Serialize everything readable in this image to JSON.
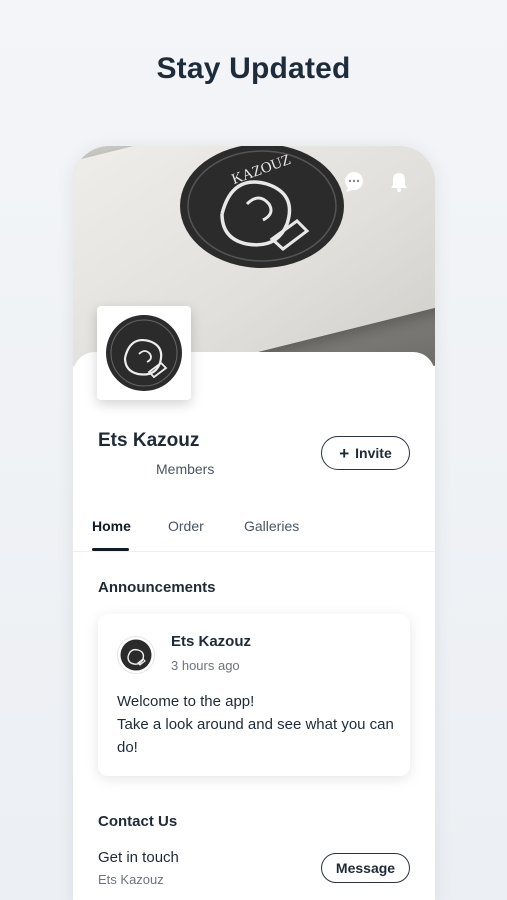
{
  "headline": "Stay Updated",
  "cover": {
    "chat_icon": "chat-bubble-icon",
    "bell_icon": "bell-icon",
    "logo_text": "KAZOUZ"
  },
  "group": {
    "name": "Ets Kazouz",
    "members_label": "Members",
    "invite_label": "Invite"
  },
  "tabs": [
    {
      "label": "Home",
      "active": true
    },
    {
      "label": "Order",
      "active": false
    },
    {
      "label": "Galleries",
      "active": false
    }
  ],
  "announcements": {
    "title": "Announcements",
    "post": {
      "author": "Ets Kazouz",
      "time": "3 hours ago",
      "body": "Welcome to the app!\nTake a look around and see what you can do!"
    }
  },
  "contact": {
    "title": "Contact Us",
    "subtitle": "Get in touch",
    "name": "Ets Kazouz",
    "message_label": "Message"
  },
  "colors": {
    "text_primary": "#1f2a37",
    "headline": "#1d2b3a",
    "muted": "#6b7480",
    "background": "#f3f5f8"
  }
}
